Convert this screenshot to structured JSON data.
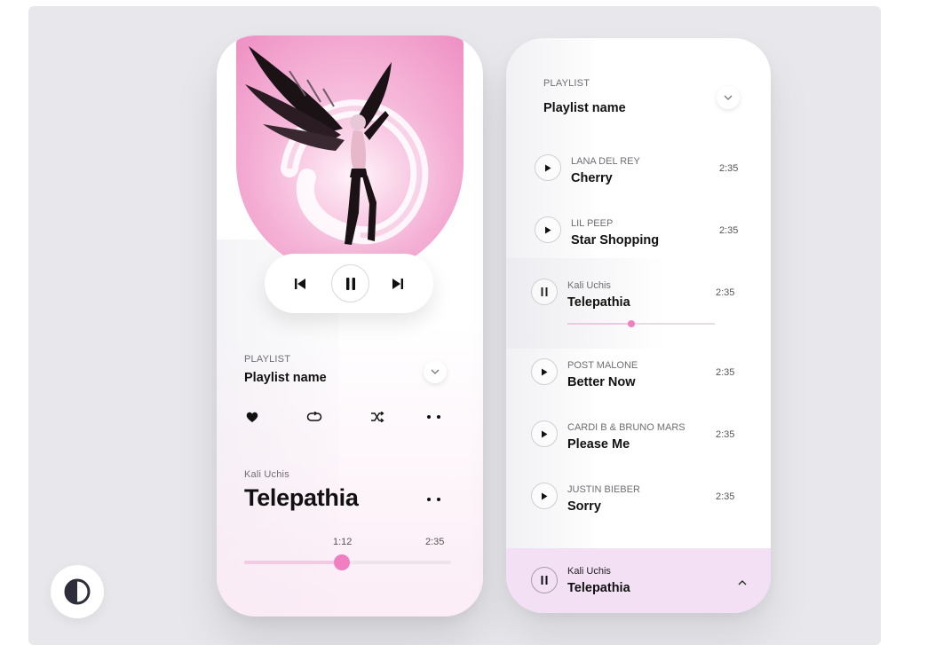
{
  "player": {
    "playlist_label": "PLAYLIST",
    "playlist_name": "Playlist name",
    "now_playing": {
      "artist": "Kali Uchis",
      "title": "Telepathia",
      "current_time": "1:12",
      "total_time": "2:35",
      "progress": 0.47
    },
    "controls": [
      "previous-icon",
      "pause-icon",
      "next-icon"
    ],
    "actions": [
      "heart-icon",
      "repeat-icon",
      "shuffle-icon",
      "more-icon"
    ]
  },
  "playlist": {
    "label": "PLAYLIST",
    "name": "Playlist name",
    "songs": [
      {
        "artist": "LANA DEL REY",
        "title": "Cherry",
        "duration": "2:35",
        "state": "play"
      },
      {
        "artist": "LIL PEEP",
        "title": "Star Shopping",
        "duration": "2:35",
        "state": "play"
      },
      {
        "artist": "Kali Uchis",
        "title": "Telepathia",
        "duration": "2:35",
        "state": "pause",
        "progress": 0.43
      },
      {
        "artist": "POST MALONE",
        "title": "Better Now",
        "duration": "2:35",
        "state": "play"
      },
      {
        "artist": "CARDI B & BRUNO MARS",
        "title": "Please Me",
        "duration": "2:35",
        "state": "play"
      },
      {
        "artist": "JUSTIN BIEBER",
        "title": "Sorry",
        "duration": "2:35",
        "state": "play"
      }
    ],
    "mini_player": {
      "artist": "Kali Uchis",
      "title": "Telepathia"
    }
  },
  "colors": {
    "accent": "#ef7fc0",
    "accent_light": "#f4c9e3",
    "mini_bar": "#f3e0f4",
    "background": "#e7e7ec"
  },
  "theme_toggle_icon": "contrast-icon"
}
